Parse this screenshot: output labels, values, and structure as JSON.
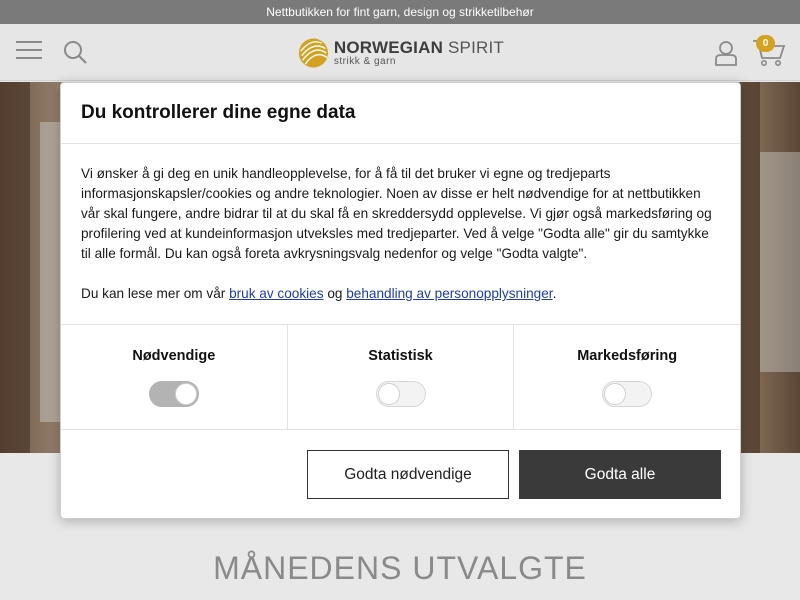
{
  "topbar": {
    "text": "Nettbutikken for fint garn, design og strikketilbehør"
  },
  "header": {
    "logo": {
      "brand_bold": "NORWEGIAN",
      "brand_light": "SPIRIT",
      "tagline": "strikk & garn"
    },
    "cart_count": "0",
    "icons": [
      "menu-icon",
      "search-icon",
      "user-icon",
      "cart-icon"
    ]
  },
  "consent": {
    "title": "Du kontrollerer dine egne data",
    "intro": "Vi ønsker å gi deg en unik handleopplevelse, for å få til det bruker vi egne og tredjeparts informasjonskapsler/cookies og andre teknologier. Noen av disse er helt nødvendige for at nettbutikken vår skal fungere, andre bidrar til at du skal få en skreddersydd opplevelse. Vi gjør også markedsføring og profilering ved at kundeinformasjon utveksles med tredjeparter. Ved å velge \"Godta alle\" gir du samtykke til alle formål. Du kan også foreta avkrysningsvalg nedenfor og velge \"Godta valgte\".",
    "read_more_prefix": "Du kan lese mer om vår",
    "link_cookies": "bruk av cookies",
    "read_more_and": "og",
    "link_personal": "behandling av personopplysninger",
    "read_more_suffix": ".",
    "categories": [
      {
        "label": "Nødvendige",
        "enabled": true
      },
      {
        "label": "Statistisk",
        "enabled": false
      },
      {
        "label": "Markedsføring",
        "enabled": false
      }
    ],
    "buttons": {
      "necessary": "Godta nødvendige",
      "all": "Godta alle"
    }
  },
  "section_title": "MÅNEDENS UTVALGTE",
  "colors": {
    "accent": "#d4a21f",
    "dark_button": "#3a3a3a",
    "link": "#1f3bb3"
  }
}
